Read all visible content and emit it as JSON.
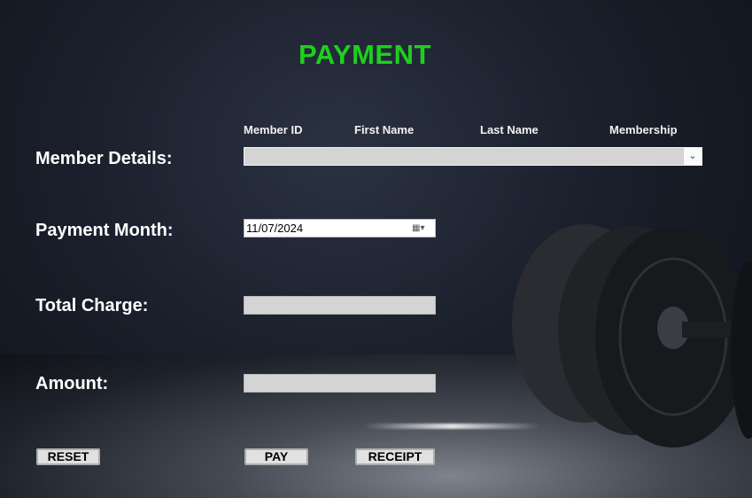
{
  "title": "PAYMENT",
  "columns": [
    "Member ID",
    "First Name",
    "Last Name",
    "Membership"
  ],
  "labels": {
    "member_details": "Member Details:",
    "payment_month": "Payment Month:",
    "total_charge": "Total Charge:",
    "amount": "Amount:"
  },
  "member_combo": {
    "value": ""
  },
  "payment_month": {
    "value": "11/07/2024"
  },
  "total_charge": {
    "value": ""
  },
  "amount": {
    "value": ""
  },
  "buttons": {
    "reset": "RESET",
    "pay": "PAY",
    "receipt": "RECEIPT"
  },
  "colors": {
    "title": "#1fcf1f"
  }
}
